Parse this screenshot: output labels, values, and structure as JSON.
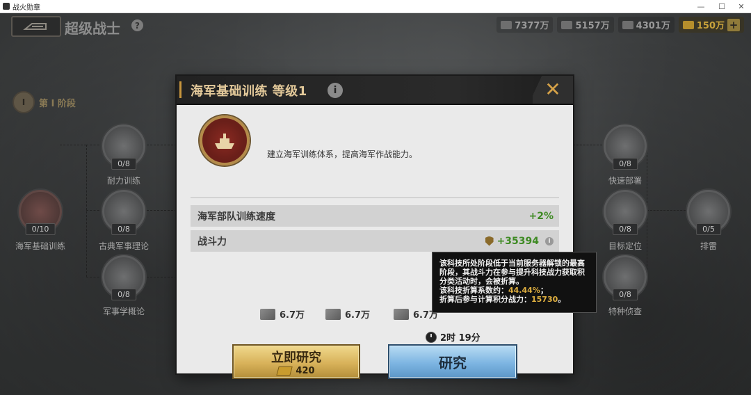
{
  "window": {
    "title": "战火勋章",
    "min": "—",
    "max": "☐",
    "close": "✕"
  },
  "header": {
    "title": "超级战士",
    "help": "?",
    "resources": [
      {
        "icon": "cash-icon",
        "value": "7377万"
      },
      {
        "icon": "steel-icon",
        "value": "5157万"
      },
      {
        "icon": "oil-icon",
        "value": "4301万"
      }
    ],
    "gold": {
      "icon": "gold-bar-icon",
      "value": "150万"
    },
    "plus": "+"
  },
  "stage": {
    "badge": "I",
    "label": "第 I 阶段"
  },
  "nodes": [
    {
      "label": "海军基础训练",
      "count": "0/10"
    },
    {
      "label": "耐力训练",
      "count": "0/8"
    },
    {
      "label": "古典军事理论",
      "count": "0/8"
    },
    {
      "label": "军事学概论",
      "count": "0/8"
    },
    {
      "label": "快速部署",
      "count": "0/8"
    },
    {
      "label": "目标定位",
      "count": "0/8"
    },
    {
      "label": "特种侦查",
      "count": "0/8"
    },
    {
      "label": "排雷",
      "count": "0/5"
    }
  ],
  "modal": {
    "title": "海军基础训练  等级1",
    "info": "i",
    "close": "✕",
    "description": "建立海军训练体系，提高海军作战能力。",
    "stats": [
      {
        "name": "海军部队训练速度",
        "value": "+2%"
      },
      {
        "name": "战斗力",
        "value": "+35394"
      }
    ],
    "small_info": "i",
    "costs": [
      {
        "icon": "cash-icon",
        "value": "6.7万"
      },
      {
        "icon": "steel-icon",
        "value": "6.7万"
      },
      {
        "icon": "oil-icon",
        "value": "6.7万"
      }
    ],
    "time": "2时 19分",
    "instant_button": {
      "label": "立即研究",
      "cost": "420"
    },
    "research_button": {
      "label": "研究"
    }
  },
  "tooltip": {
    "line1": "该科技所处阶段低于当前服务器解锁的最高阶段，其战斗力在参与提升科技战力获取积分类活动时，会被折算。",
    "line2_label": "该科技折算系数约：",
    "line2_value": "44.44%",
    "line2_suffix": "；",
    "line3_label": "折算后参与计算积分战力：",
    "line3_value": "15730",
    "line3_suffix": "。"
  }
}
